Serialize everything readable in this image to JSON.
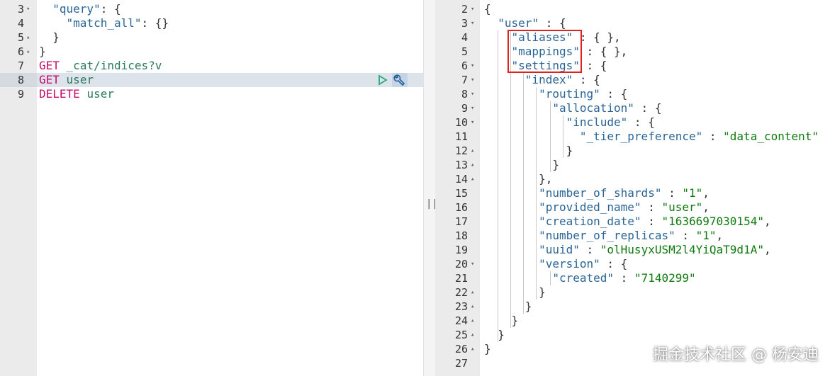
{
  "left_editor": {
    "lines": [
      {
        "num": "3",
        "fold": "▾",
        "segments": [
          {
            "cls": "punc",
            "text": "  "
          },
          {
            "cls": "key",
            "text": "\"query\""
          },
          {
            "cls": "punc",
            "text": ": {"
          }
        ]
      },
      {
        "num": "4",
        "fold": "",
        "segments": [
          {
            "cls": "punc",
            "text": "    "
          },
          {
            "cls": "key",
            "text": "\"match_all\""
          },
          {
            "cls": "punc",
            "text": ": {}"
          }
        ]
      },
      {
        "num": "5",
        "fold": "▴",
        "segments": [
          {
            "cls": "punc",
            "text": "  }"
          }
        ]
      },
      {
        "num": "6",
        "fold": "▴",
        "segments": [
          {
            "cls": "punc",
            "text": "}"
          }
        ]
      },
      {
        "num": "7",
        "fold": "",
        "segments": [
          {
            "cls": "kw",
            "text": "GET"
          },
          {
            "cls": "punc",
            "text": " "
          },
          {
            "cls": "url",
            "text": "_cat/indices?v"
          }
        ]
      },
      {
        "num": "8",
        "fold": "",
        "active": true,
        "segments": [
          {
            "cls": "kw",
            "text": "GET"
          },
          {
            "cls": "punc",
            "text": " "
          },
          {
            "cls": "url",
            "text": "user"
          }
        ]
      },
      {
        "num": "9",
        "fold": "",
        "segments": [
          {
            "cls": "kw",
            "text": "DELETE"
          },
          {
            "cls": "punc",
            "text": " "
          },
          {
            "cls": "url",
            "text": "user"
          }
        ]
      }
    ],
    "actions": {
      "run_icon": "play-icon",
      "settings_icon": "wrench-icon"
    }
  },
  "divider": {
    "grip": "||"
  },
  "right_editor": {
    "lines": [
      {
        "num": "2",
        "fold": "▾",
        "segments": [
          {
            "cls": "punc",
            "text": "{"
          }
        ]
      },
      {
        "num": "3",
        "fold": "▾",
        "segments": [
          {
            "cls": "punc",
            "text": "  "
          },
          {
            "cls": "key",
            "text": "\"user\""
          },
          {
            "cls": "punc",
            "text": " : {"
          }
        ]
      },
      {
        "num": "4",
        "fold": "",
        "segments": [
          {
            "cls": "punc",
            "text": "    "
          },
          {
            "cls": "key",
            "text": "\"aliases\""
          },
          {
            "cls": "punc",
            "text": " : { },"
          }
        ]
      },
      {
        "num": "5",
        "fold": "",
        "segments": [
          {
            "cls": "punc",
            "text": "    "
          },
          {
            "cls": "key",
            "text": "\"mappings\""
          },
          {
            "cls": "punc",
            "text": " : { },"
          }
        ]
      },
      {
        "num": "6",
        "fold": "▾",
        "segments": [
          {
            "cls": "punc",
            "text": "    "
          },
          {
            "cls": "key",
            "text": "\"settings\""
          },
          {
            "cls": "punc",
            "text": " : {"
          }
        ]
      },
      {
        "num": "7",
        "fold": "▾",
        "segments": [
          {
            "cls": "punc",
            "text": "      "
          },
          {
            "cls": "key",
            "text": "\"index\""
          },
          {
            "cls": "punc",
            "text": " : {"
          }
        ]
      },
      {
        "num": "8",
        "fold": "▾",
        "segments": [
          {
            "cls": "punc",
            "text": "        "
          },
          {
            "cls": "key",
            "text": "\"routing\""
          },
          {
            "cls": "punc",
            "text": " : {"
          }
        ]
      },
      {
        "num": "9",
        "fold": "▾",
        "segments": [
          {
            "cls": "punc",
            "text": "          "
          },
          {
            "cls": "key",
            "text": "\"allocation\""
          },
          {
            "cls": "punc",
            "text": " : {"
          }
        ]
      },
      {
        "num": "10",
        "fold": "▾",
        "segments": [
          {
            "cls": "punc",
            "text": "            "
          },
          {
            "cls": "key",
            "text": "\"include\""
          },
          {
            "cls": "punc",
            "text": " : {"
          }
        ]
      },
      {
        "num": "11",
        "fold": "",
        "segments": [
          {
            "cls": "punc",
            "text": "              "
          },
          {
            "cls": "key",
            "text": "\"_tier_preference\""
          },
          {
            "cls": "punc",
            "text": " : "
          },
          {
            "cls": "str",
            "text": "\"data_content\""
          }
        ]
      },
      {
        "num": "12",
        "fold": "▴",
        "segments": [
          {
            "cls": "punc",
            "text": "            }"
          }
        ]
      },
      {
        "num": "13",
        "fold": "▴",
        "segments": [
          {
            "cls": "punc",
            "text": "          }"
          }
        ]
      },
      {
        "num": "14",
        "fold": "▴",
        "segments": [
          {
            "cls": "punc",
            "text": "        },"
          }
        ]
      },
      {
        "num": "15",
        "fold": "",
        "segments": [
          {
            "cls": "punc",
            "text": "        "
          },
          {
            "cls": "key",
            "text": "\"number_of_shards\""
          },
          {
            "cls": "punc",
            "text": " : "
          },
          {
            "cls": "str",
            "text": "\"1\""
          },
          {
            "cls": "punc",
            "text": ","
          }
        ]
      },
      {
        "num": "16",
        "fold": "",
        "segments": [
          {
            "cls": "punc",
            "text": "        "
          },
          {
            "cls": "key",
            "text": "\"provided_name\""
          },
          {
            "cls": "punc",
            "text": " : "
          },
          {
            "cls": "str",
            "text": "\"user\""
          },
          {
            "cls": "punc",
            "text": ","
          }
        ]
      },
      {
        "num": "17",
        "fold": "",
        "segments": [
          {
            "cls": "punc",
            "text": "        "
          },
          {
            "cls": "key",
            "text": "\"creation_date\""
          },
          {
            "cls": "punc",
            "text": " : "
          },
          {
            "cls": "str",
            "text": "\"1636697030154\""
          },
          {
            "cls": "punc",
            "text": ","
          }
        ]
      },
      {
        "num": "18",
        "fold": "",
        "segments": [
          {
            "cls": "punc",
            "text": "        "
          },
          {
            "cls": "key",
            "text": "\"number_of_replicas\""
          },
          {
            "cls": "punc",
            "text": " : "
          },
          {
            "cls": "str",
            "text": "\"1\""
          },
          {
            "cls": "punc",
            "text": ","
          }
        ]
      },
      {
        "num": "19",
        "fold": "",
        "segments": [
          {
            "cls": "punc",
            "text": "        "
          },
          {
            "cls": "key",
            "text": "\"uuid\""
          },
          {
            "cls": "punc",
            "text": " : "
          },
          {
            "cls": "str",
            "text": "\"olHusyxUSM2l4YiQaT9d1A\""
          },
          {
            "cls": "punc",
            "text": ","
          }
        ]
      },
      {
        "num": "20",
        "fold": "▾",
        "segments": [
          {
            "cls": "punc",
            "text": "        "
          },
          {
            "cls": "key",
            "text": "\"version\""
          },
          {
            "cls": "punc",
            "text": " : {"
          }
        ]
      },
      {
        "num": "21",
        "fold": "",
        "segments": [
          {
            "cls": "punc",
            "text": "          "
          },
          {
            "cls": "key",
            "text": "\"created\""
          },
          {
            "cls": "punc",
            "text": " : "
          },
          {
            "cls": "str",
            "text": "\"7140299\""
          }
        ]
      },
      {
        "num": "22",
        "fold": "▴",
        "segments": [
          {
            "cls": "punc",
            "text": "        }"
          }
        ]
      },
      {
        "num": "23",
        "fold": "▴",
        "segments": [
          {
            "cls": "punc",
            "text": "      }"
          }
        ]
      },
      {
        "num": "24",
        "fold": "▴",
        "segments": [
          {
            "cls": "punc",
            "text": "    }"
          }
        ]
      },
      {
        "num": "25",
        "fold": "▴",
        "segments": [
          {
            "cls": "punc",
            "text": "  }"
          }
        ]
      },
      {
        "num": "26",
        "fold": "▴",
        "segments": [
          {
            "cls": "punc",
            "text": "}"
          }
        ]
      },
      {
        "num": "27",
        "fold": "",
        "segments": []
      }
    ]
  },
  "watermark": "掘金技术社区 @ 杨安迪"
}
